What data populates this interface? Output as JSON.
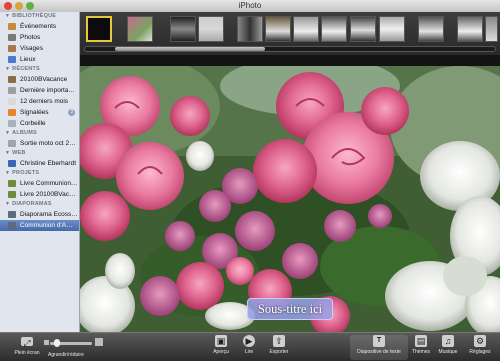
{
  "window": {
    "title": "iPhoto"
  },
  "sidebar": {
    "sections": [
      {
        "header": "BIBLIOTHÈQUE",
        "items": [
          {
            "label": "Événements",
            "icon": "events-icon",
            "color": "#c58b3a"
          },
          {
            "label": "Photos",
            "icon": "photos-icon",
            "color": "#7a7a7a"
          },
          {
            "label": "Visages",
            "icon": "faces-icon",
            "color": "#a8794e"
          },
          {
            "label": "Lieux",
            "icon": "places-icon",
            "color": "#4a7bd0"
          }
        ]
      },
      {
        "header": "RÉCENTS",
        "items": [
          {
            "label": "20100BVacance",
            "icon": "event-recent-icon",
            "color": "#8b6d4a"
          },
          {
            "label": "Dernière importa…",
            "icon": "last-import-icon",
            "color": "#9e9e9e"
          },
          {
            "label": "12 derniers mois",
            "icon": "calendar-icon",
            "color": "#d9d9d9"
          },
          {
            "label": "Signalées",
            "icon": "flag-icon",
            "color": "#e7832b",
            "badge": "3"
          },
          {
            "label": "Corbeille",
            "icon": "trash-icon",
            "color": "#a9b0bb"
          }
        ]
      },
      {
        "header": "ALBUMS",
        "items": [
          {
            "label": "Sortie moto oct 2…",
            "icon": "album-icon",
            "color": "#9aa6b8"
          }
        ]
      },
      {
        "header": "WEB",
        "items": [
          {
            "label": "Christine Eberhardt",
            "icon": "web-album-icon",
            "color": "#3b66b9"
          }
        ]
      },
      {
        "header": "PROJETS",
        "items": [
          {
            "label": "Livre Communion…",
            "icon": "book-icon",
            "color": "#6e8c3c"
          },
          {
            "label": "Livre 20100BVac…",
            "icon": "book-icon",
            "color": "#6e8c3c"
          }
        ]
      },
      {
        "header": "DIAPORAMAS",
        "items": [
          {
            "label": "Diaporama Ecoss…",
            "icon": "slideshow-icon",
            "color": "#5c6a7d"
          },
          {
            "label": "Communion d'A…",
            "icon": "slideshow-icon",
            "color": "#5c6a7d",
            "selected": true
          }
        ]
      }
    ]
  },
  "viewer": {
    "subtitle_text": "Sous-titre ici"
  },
  "toolbar": {
    "fullscreen": "Plein écran",
    "zoom": "Agrandir/réduire",
    "preview": "Aperçu",
    "play": "Lire",
    "export": "Exporter",
    "text_slide": "Diapositive de texte",
    "themes": "Thèmes",
    "music": "Musique",
    "settings": "Réglages"
  }
}
